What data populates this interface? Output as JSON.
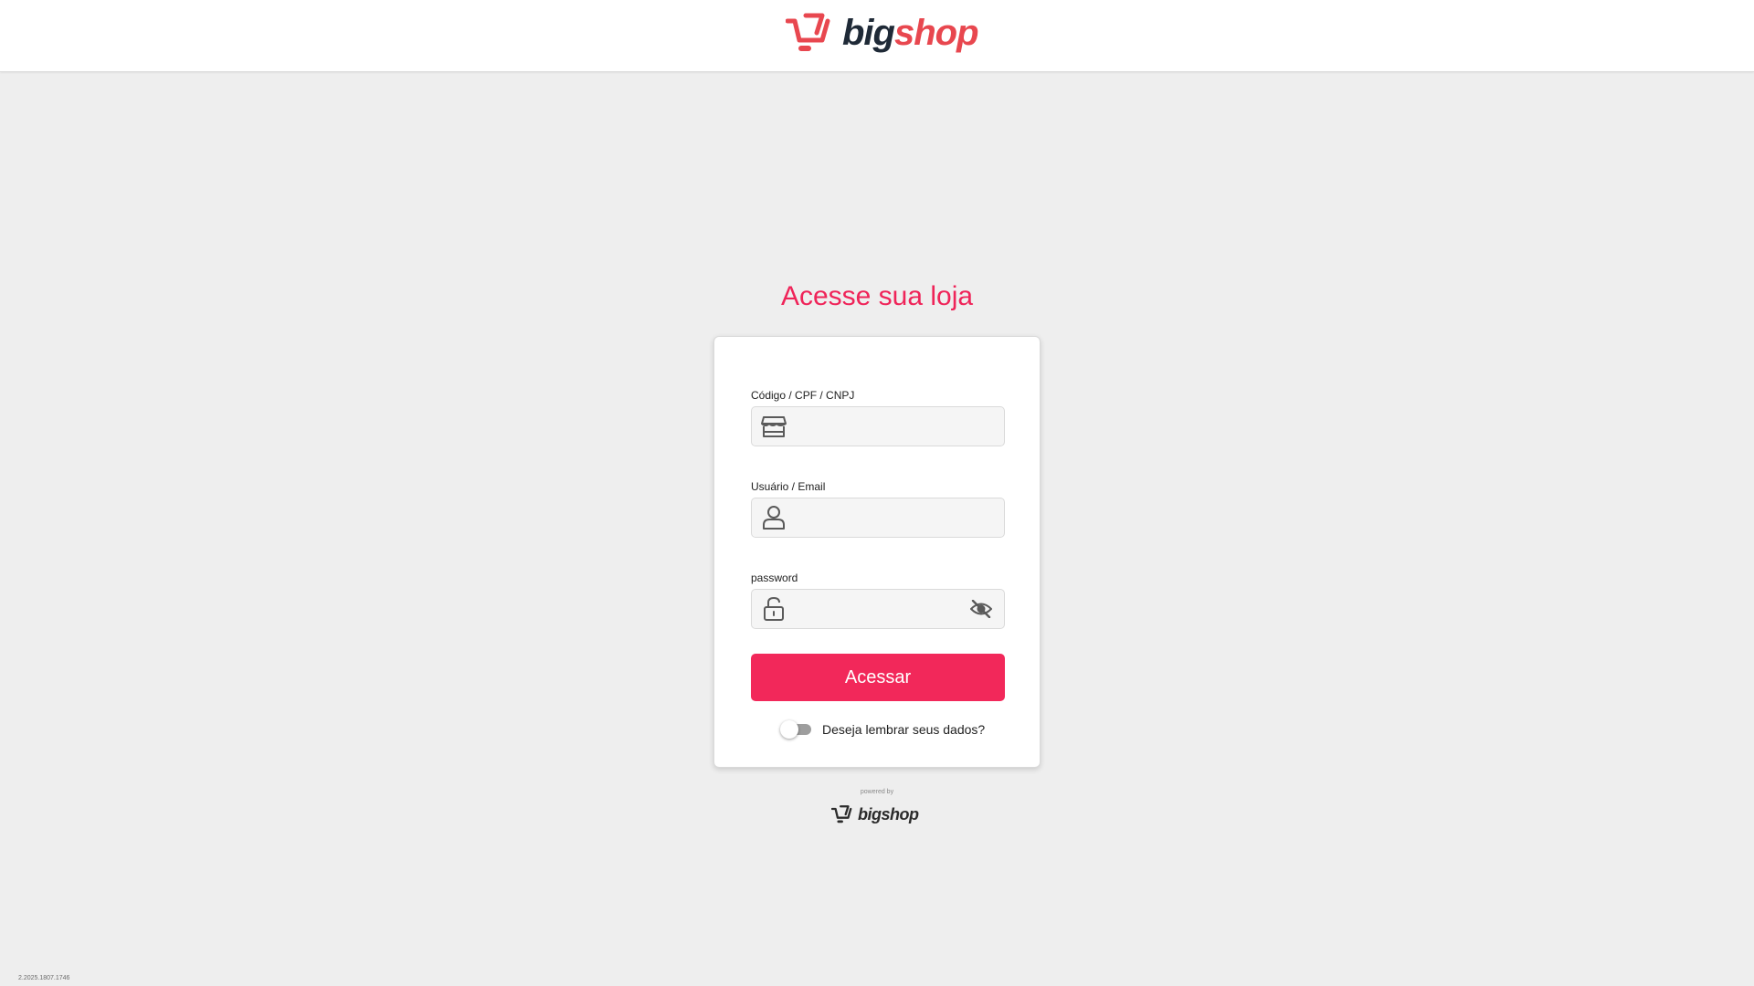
{
  "header": {
    "brand": {
      "part1": "big",
      "part2": "shop"
    },
    "logo_icon": "shopping-cart-icon",
    "colors": {
      "logo_cart": "#e8474f",
      "logo_big": "#1f2a37",
      "logo_shop": "#e8474f"
    }
  },
  "login": {
    "title": "Acesse sua loja",
    "fields": {
      "store": {
        "label": "Código / CPF / CNPJ",
        "value": "",
        "icon": "store-icon"
      },
      "user": {
        "label": "Usuário / Email",
        "value": "",
        "icon": "user-icon"
      },
      "password": {
        "label": "password",
        "value": "",
        "icon": "lock-icon",
        "toggle_icon": "eye-off-icon"
      }
    },
    "submit_label": "Acessar",
    "remember": {
      "label": "Deseja lembrar seus dados?",
      "checked": false
    }
  },
  "footer": {
    "powered_by": "powered by",
    "brand": "bigshop",
    "version": "2.2025.1807.1746"
  },
  "colors": {
    "accent": "#f2285a",
    "title": "#ef2459",
    "background": "#eeeeee"
  }
}
